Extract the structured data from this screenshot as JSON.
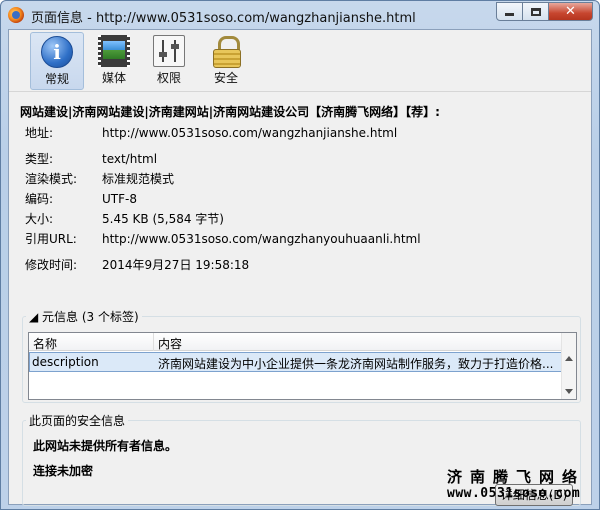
{
  "window": {
    "title": "页面信息 - http://www.0531soso.com/wangzhanjianshe.html",
    "minimize_icon": "minimize-icon",
    "maximize_icon": "maximize-icon",
    "close_glyph": "✕"
  },
  "toolbar": {
    "tabs": [
      {
        "label": "常规",
        "icon": "info-icon",
        "selected": true
      },
      {
        "label": "媒体",
        "icon": "media-icon",
        "selected": false
      },
      {
        "label": "权限",
        "icon": "permissions-icon",
        "selected": false
      },
      {
        "label": "安全",
        "icon": "lock-icon",
        "selected": false
      }
    ],
    "info_glyph": "i"
  },
  "general": {
    "page_name": "网站建设|济南网站建设|济南建网站|济南网站建设公司【济南腾飞网络】【荐】:",
    "address_label": "地址:",
    "address_value": "http://www.0531soso.com/wangzhanjianshe.html",
    "type_label": "类型:",
    "type_value": "text/html",
    "render_label": "渲染模式:",
    "render_value": "标准规范模式",
    "encoding_label": "编码:",
    "encoding_value": "UTF-8",
    "size_label": "大小:",
    "size_value": "5.45 KB (5,584 字节)",
    "referrer_label": "引用URL:",
    "referrer_value": "http://www.0531soso.com/wangzhanyouhuaanli.html",
    "modified_label": "修改时间:",
    "modified_value": "2014年9月27日 19:58:18"
  },
  "meta": {
    "title": "◢ 元信息 (3 个标签)",
    "columns": [
      "名称",
      "内容"
    ],
    "rows": [
      {
        "name": "description",
        "content": "济南网站建设为中小企业提供一条龙济南网站制作服务，致力于打造价格..."
      }
    ]
  },
  "security": {
    "title": "此页面的安全信息",
    "owner_text": "此网站未提供所有者信息。",
    "connection_text": "连接未加密",
    "detail_button": "详细信息(D)"
  },
  "watermark": {
    "line1": "济南腾飞网络",
    "line2": "www.0531soso.com"
  }
}
